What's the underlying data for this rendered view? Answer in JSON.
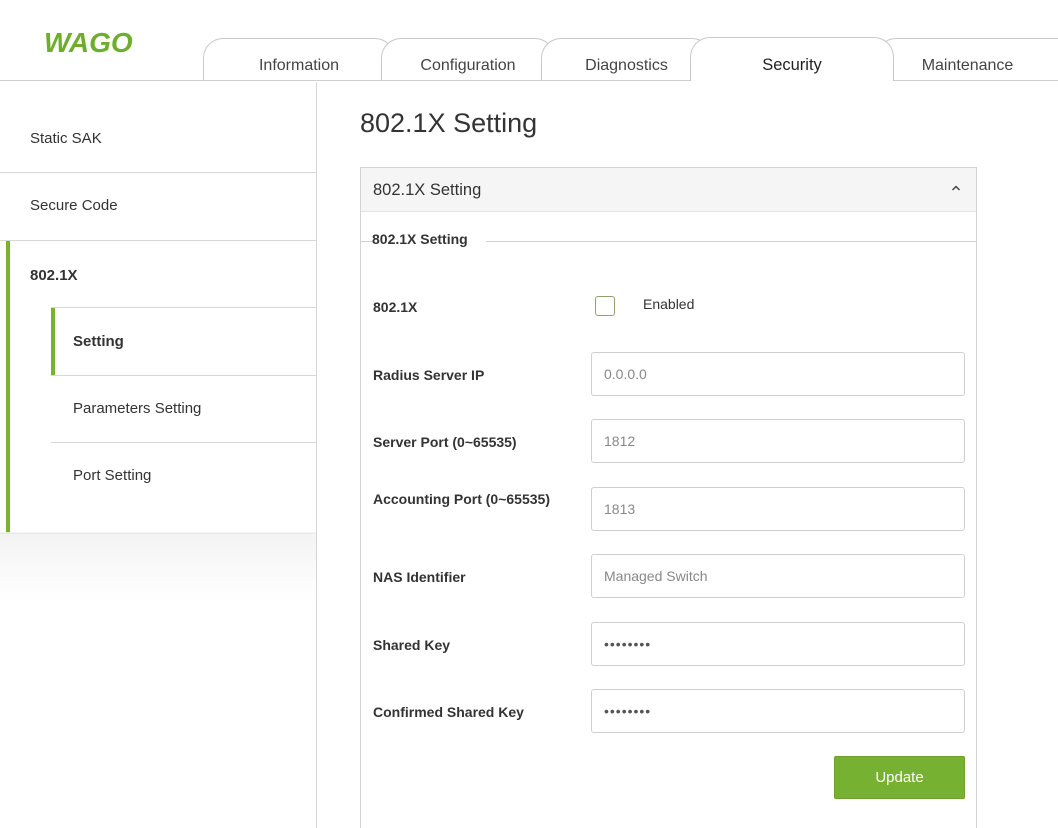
{
  "brand": {
    "logo_text": "WAGO",
    "accent_color": "#76b132"
  },
  "tabs": [
    {
      "label": "Information",
      "active": false
    },
    {
      "label": "Configuration",
      "active": false
    },
    {
      "label": "Diagnostics",
      "active": false
    },
    {
      "label": "Security",
      "active": true
    },
    {
      "label": "Maintenance",
      "active": false
    }
  ],
  "sidebar": {
    "items": [
      {
        "label": "Static SAK"
      },
      {
        "label": "Secure Code"
      },
      {
        "label": "802.1X",
        "active": true
      }
    ],
    "subitems": [
      {
        "label": "Setting",
        "active": true
      },
      {
        "label": "Parameters Setting"
      },
      {
        "label": "Port Setting"
      }
    ]
  },
  "main": {
    "page_title": "802.1X Setting",
    "panel_title": "802.1X Setting",
    "fieldset_legend": "802.1X Setting",
    "fields": {
      "enable": {
        "label": "802.1X",
        "checkbox_label": "Enabled",
        "checked": false
      },
      "radius_ip": {
        "label": "Radius Server IP",
        "placeholder": "0.0.0.0"
      },
      "server_port": {
        "label": "Server Port (0~65535)",
        "placeholder": "1812"
      },
      "accounting_port": {
        "label": "Accounting Port (0~65535)",
        "placeholder": "1813"
      },
      "nas_identifier": {
        "label": "NAS Identifier",
        "placeholder": "Managed Switch"
      },
      "shared_key": {
        "label": "Shared Key",
        "value": "••••••••"
      },
      "confirmed_shared_key": {
        "label": "Confirmed Shared Key",
        "value": "••••••••"
      }
    },
    "update_label": "Update"
  }
}
